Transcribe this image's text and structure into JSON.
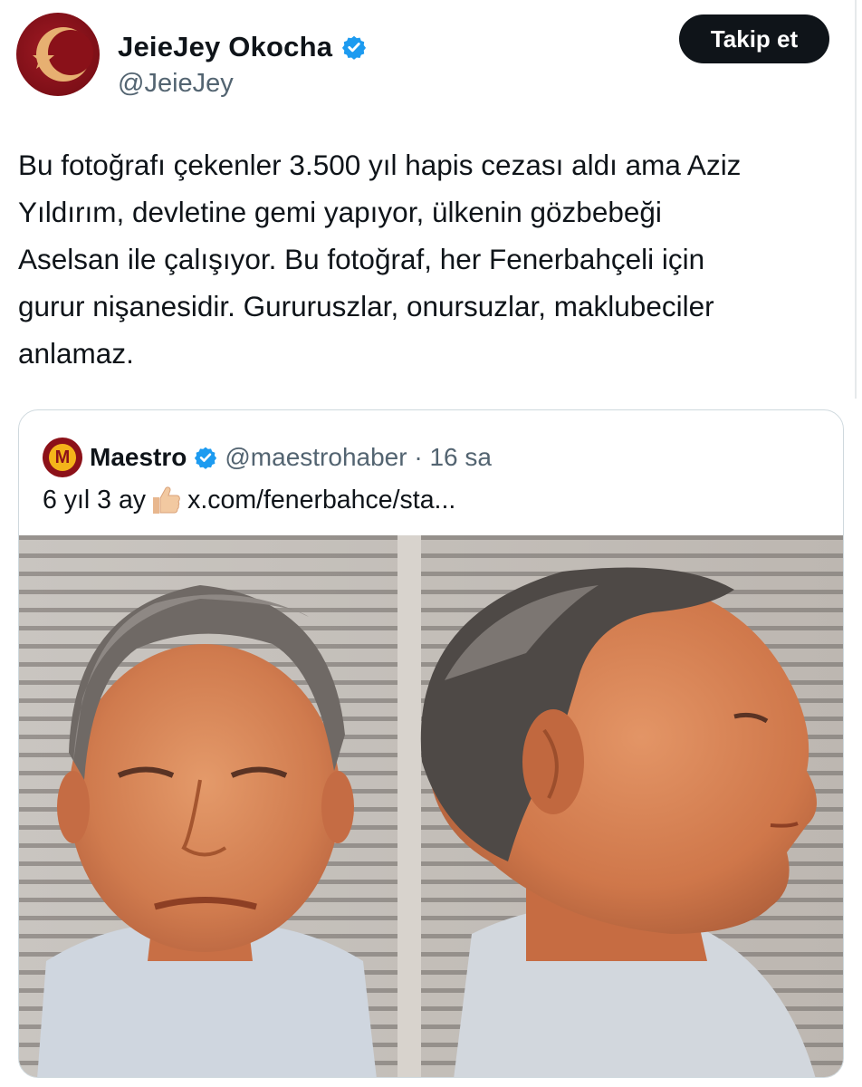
{
  "author": {
    "display_name": "JeieJey Okocha",
    "handle": "@JeieJey",
    "verified": true,
    "follow_label": "Takip et",
    "avatar_icon": "crescent-star-icon"
  },
  "tweet": {
    "text": "Bu fotoğrafı çekenler 3.500 yıl hapis cezası aldı ama Aziz\nYıldırım, devletine gemi yapıyor, ülkenin gözbebeği\nAselsan ile çalışıyor. Bu fotoğraf, her Fenerbahçeli için\ngurur nişanesidir. Gururuszlar, onursuzlar, maklubeciler\nanlamaz."
  },
  "quote": {
    "avatar_letter": "M",
    "display_name": "Maestro",
    "handle_time": "@maestrohaber · 16 sa",
    "text_prefix": "6 yıl 3 ay",
    "emoji_icon": "thumbs-up-icon",
    "link": "x.com/fenerbahce/sta..."
  },
  "colors": {
    "text": "#0f1419",
    "muted": "#536471",
    "verified": "#1d9bf0",
    "border": "#cfd9de"
  }
}
